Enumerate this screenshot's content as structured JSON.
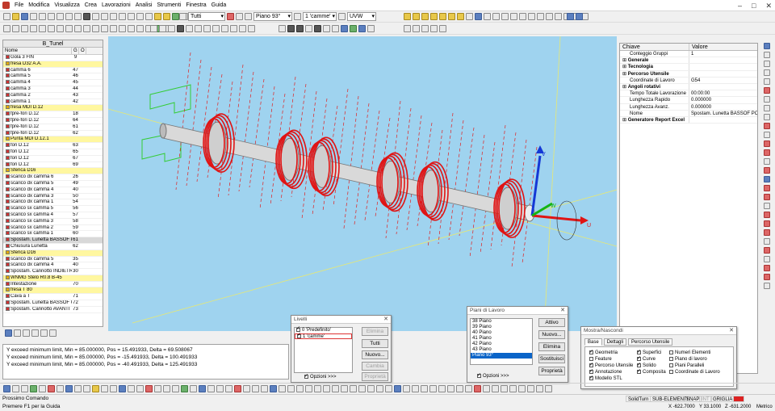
{
  "menu": [
    "File",
    "Modifica",
    "Visualizza",
    "Crea",
    "Lavorazioni",
    "Analisi",
    "Strumenti",
    "Finestra",
    "Guida"
  ],
  "toolbar": {
    "filter_value": "Tutti",
    "plane_value": "Piano 93°",
    "layer_value": "1 'camme'",
    "view_value": "UVW"
  },
  "tree": {
    "title": "B_Tunel",
    "col_name": "Nome",
    "col_g": "G",
    "col_o": "O",
    "rows": [
      {
        "name": "Gola 3 FIN",
        "g": "9",
        "o": "",
        "type": "op"
      },
      {
        "name": "fresa D32 A.A.",
        "g": "",
        "o": "",
        "type": "tool"
      },
      {
        "name": "camma 6",
        "g": "47",
        "o": "",
        "type": "op"
      },
      {
        "name": "camma 5",
        "g": "46",
        "o": "",
        "type": "op"
      },
      {
        "name": "camma 4",
        "g": "45",
        "o": "",
        "type": "op"
      },
      {
        "name": "camma 3",
        "g": "44",
        "o": "",
        "type": "op"
      },
      {
        "name": "camma 2",
        "g": "43",
        "o": "",
        "type": "op"
      },
      {
        "name": "camma 1",
        "g": "42",
        "o": "",
        "type": "op"
      },
      {
        "name": "fresa MDI D.12",
        "g": "",
        "o": "",
        "type": "tool"
      },
      {
        "name": "fpre-fori D.12",
        "g": "18",
        "o": "",
        "type": "op"
      },
      {
        "name": "fpre-fori D.12",
        "g": "64",
        "o": "",
        "type": "op"
      },
      {
        "name": "fpre-fori D.12",
        "g": "61",
        "o": "",
        "type": "op"
      },
      {
        "name": "fpre-fori D.12",
        "g": "62",
        "o": "",
        "type": "op"
      },
      {
        "name": "Punta MDI D.12.1",
        "g": "",
        "o": "",
        "type": "tool"
      },
      {
        "name": "fori D.12",
        "g": "63",
        "o": "",
        "type": "op"
      },
      {
        "name": "fori D.12",
        "g": "65",
        "o": "",
        "type": "op"
      },
      {
        "name": "fori D.12",
        "g": "67",
        "o": "",
        "type": "op"
      },
      {
        "name": "fori D.12",
        "g": "69",
        "o": "",
        "type": "op"
      },
      {
        "name": "Sferica D16",
        "g": "",
        "o": "",
        "type": "tool"
      },
      {
        "name": "scarico dx camma 6",
        "g": "26",
        "o": "",
        "type": "op"
      },
      {
        "name": "scarico dx camma 5",
        "g": "49",
        "o": "",
        "type": "op"
      },
      {
        "name": "scarico dx camma 4",
        "g": "40",
        "o": "",
        "type": "op"
      },
      {
        "name": "scarico dx camma 3",
        "g": "50",
        "o": "",
        "type": "op"
      },
      {
        "name": "scarico dx camma 1",
        "g": "54",
        "o": "",
        "type": "op"
      },
      {
        "name": "scarico sx camma 5",
        "g": "56",
        "o": "",
        "type": "op"
      },
      {
        "name": "scarico sx camma 4",
        "g": "57",
        "o": "",
        "type": "op"
      },
      {
        "name": "scarico sx camma 3",
        "g": "58",
        "o": "",
        "type": "op"
      },
      {
        "name": "scarico sx camma 2",
        "g": "59",
        "o": "",
        "type": "op"
      },
      {
        "name": "scarico sx camma 1",
        "g": "60",
        "o": "",
        "type": "op"
      },
      {
        "name": "Spostam. Lunetta BASSOF P...",
        "g": "61",
        "o": "",
        "type": "sel"
      },
      {
        "name": "Chiusura Lunetta",
        "g": "62",
        "o": "",
        "type": "op"
      },
      {
        "name": "Sferica D16",
        "g": "",
        "o": "",
        "type": "tool"
      },
      {
        "name": "scarico dx camma 5",
        "g": "35",
        "o": "",
        "type": "op"
      },
      {
        "name": "scarico dx camma 4",
        "g": "40",
        "o": "",
        "type": "op"
      },
      {
        "name": "Spostam. Cannotto INDIETRO",
        "g": "30",
        "o": "",
        "type": "op"
      },
      {
        "name": "WNMG Stelo R0.8 B-45",
        "g": "",
        "o": "",
        "type": "tool"
      },
      {
        "name": "Intestazione",
        "g": "70",
        "o": "",
        "type": "op"
      },
      {
        "name": "fresa T 80",
        "g": "",
        "o": "",
        "type": "tool"
      },
      {
        "name": "Cava a T",
        "g": "71",
        "o": "",
        "type": "op"
      },
      {
        "name": "Spostam. Lunetta BASSOF CE...",
        "g": "72",
        "o": "",
        "type": "op"
      },
      {
        "name": "Spostam. Cannotto AVANTI",
        "g": "73",
        "o": "",
        "type": "op"
      }
    ]
  },
  "viewport": {
    "axis_x": "U",
    "axis_y": "W",
    "axis_z": "V"
  },
  "props": {
    "col_key": "Chiave",
    "col_value": "Valore",
    "rows": [
      {
        "k": "Conteggio Gruppi",
        "v": "1",
        "grp": false
      },
      {
        "k": "Generale",
        "v": "",
        "grp": true
      },
      {
        "k": "Tecnologia",
        "v": "",
        "grp": true
      },
      {
        "k": "Percorso Utensile",
        "v": "",
        "grp": true
      },
      {
        "k": "Coordinate di Lavoro",
        "v": "G54",
        "grp": false
      },
      {
        "k": "Angoli rotativi",
        "v": "",
        "grp": true
      },
      {
        "k": "Tempo Totale Lavorazione",
        "v": "00:00:00",
        "grp": false
      },
      {
        "k": "Lunghezza Rapido",
        "v": "0.000000",
        "grp": false
      },
      {
        "k": "Lunghezza Avanz.",
        "v": "0.000000",
        "grp": false
      },
      {
        "k": "Nome",
        "v": "Spostam. Lunetta BASSOF PO...",
        "grp": false
      },
      {
        "k": "Generatore Report Excel",
        "v": "",
        "grp": true
      }
    ]
  },
  "console": [
    "Y exceed minimum limit, Min = 85.000000, Pos = 15.491933, Delta = 69.508067",
    "Y exceed minimum limit, Min = 85.000000, Pos = -15.491933, Delta = 100.491933",
    "Y exceed minimum limit, Min = 85.000000, Pos = -40.491933, Delta = 125.491933"
  ],
  "livelli": {
    "title": "Livelli",
    "items": [
      "0 'Predefinito'",
      "1 'camme'"
    ],
    "btn_elimina": "Elimina",
    "btn_tutti": "Tutti",
    "btn_nuovo": "Nuovo...",
    "btn_cambia": "Cambia",
    "btn_proprieta": "Proprietà",
    "opzioni": "Opzioni >>>"
  },
  "piani": {
    "title": "Piani di Lavoro",
    "items": [
      "38 Piano",
      "39 Piano",
      "40 Piano",
      "41 Piano",
      "42 Piano",
      "43 Piano",
      "Piano 93°"
    ],
    "btn_attivo": "Attivo",
    "btn_nuovo": "Nuovo...",
    "btn_elimina": "Elimina",
    "btn_sostituisci": "Sostituisci",
    "btn_proprieta": "Proprietà",
    "opzioni": "Opzioni >>>"
  },
  "mostra": {
    "title": "Mostra/Nascondi",
    "tabs": [
      "Base",
      "Dettagli",
      "Percorso Utensile"
    ],
    "col1": [
      {
        "label": "Geometria",
        "on": true
      },
      {
        "label": "Feature",
        "on": false
      },
      {
        "label": "Percorso Utensile",
        "on": true
      },
      {
        "label": "Annotazione",
        "on": true
      },
      {
        "label": "Modello STL",
        "on": true
      }
    ],
    "col2": [
      {
        "label": "Superfici",
        "on": true
      },
      {
        "label": "Curve",
        "on": true
      },
      {
        "label": "Solido",
        "on": true
      },
      {
        "label": "Composita",
        "on": true
      }
    ],
    "col3": [
      {
        "label": "Numeri Elementi",
        "on": false
      },
      {
        "label": "Piano di lavoro",
        "on": false
      },
      {
        "label": "Piani Paralleli",
        "on": false
      },
      {
        "label": "Coordinate di Lavoro",
        "on": false
      }
    ]
  },
  "status": {
    "prompt": "Prossimo Comando",
    "help": "Premere F1 per la Guida",
    "mode": "SolidTurn",
    "sub": "SUB-ELEMENTI",
    "snap": "SNAP",
    "int": "INT",
    "grid": "GRIGLIA",
    "x": "X -622.7000",
    "y": "Y 33.1000",
    "z": "Z -631.2000",
    "unit": "Metrico"
  }
}
